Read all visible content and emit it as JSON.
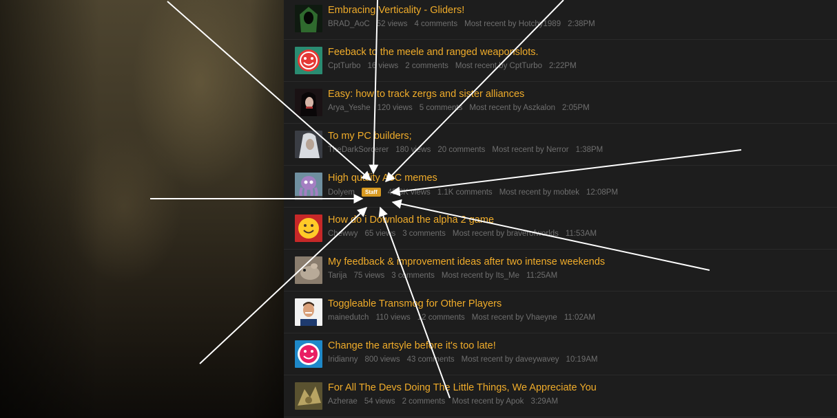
{
  "threads": [
    {
      "title": "Embracing Verticality - Gliders!",
      "author": "BRAD_AoC",
      "views": "52 views",
      "comments": "4 comments",
      "recent": "Most recent by Hotchy1989",
      "time": "2:38PM",
      "badge": "",
      "avatar": "hooded-figure-avatar"
    },
    {
      "title": "Feeback to the meele and ranged weaponslots.",
      "author": "CptTurbo",
      "views": "16 views",
      "comments": "2 comments",
      "recent": "Most recent by CptTurbo",
      "time": "2:22PM",
      "badge": "",
      "avatar": "red-smiley-avatar"
    },
    {
      "title": "Easy: how to track zergs and sister alliances",
      "author": "Arya_Yeshe",
      "views": "120 views",
      "comments": "5 comments",
      "recent": "Most recent by Aszkalon",
      "time": "2:05PM",
      "badge": "",
      "avatar": "dark-hair-portrait-avatar"
    },
    {
      "title": "To my PC builders;",
      "author": "TheDarkSorcerer",
      "views": "180 views",
      "comments": "20 comments",
      "recent": "Most recent by Nerror",
      "time": "1:38PM",
      "badge": "",
      "avatar": "white-hair-portrait-avatar"
    },
    {
      "title": "High quality AoC memes",
      "author": "Dolyem",
      "views": "45.8K views",
      "comments": "1.1K comments",
      "recent": "Most recent by mobtek",
      "time": "12:08PM",
      "badge": "Staff",
      "avatar": "purple-octopus-avatar"
    },
    {
      "title": "How do i Download the alpha 2 game",
      "author": "Chewwy",
      "views": "65 views",
      "comments": "3 comments",
      "recent": "Most recent by braverofworlds",
      "time": "11:53AM",
      "badge": "",
      "avatar": "yellow-smiley-avatar"
    },
    {
      "title": "My feedback & improvement ideas after two intense weekends",
      "author": "Tarija",
      "views": "75 views",
      "comments": "3 comments",
      "recent": "Most recent by Its_Me",
      "time": "11:25AM",
      "badge": "",
      "avatar": "rodent-photo-avatar"
    },
    {
      "title": "Toggleable Transmog for Other Players",
      "author": "mainedutch",
      "views": "110 views",
      "comments": "12 comments",
      "recent": "Most recent by Vhaeyne",
      "time": "11:02AM",
      "badge": "",
      "avatar": "man-photo-avatar"
    },
    {
      "title": "Change the artsyle before it's too late!",
      "author": "Iridianny",
      "views": "800 views",
      "comments": "43 comments",
      "recent": "Most recent by daveywavey",
      "time": "10:19AM",
      "badge": "",
      "avatar": "pink-smiley-avatar"
    },
    {
      "title": "For All The Devs Doing The Little Things, We Appreciate You",
      "author": "Azherae",
      "views": "54 views",
      "comments": "2 comments",
      "recent": "Most recent by Apok",
      "time": "3:29AM",
      "badge": "",
      "avatar": "creature-art-avatar"
    }
  ],
  "colors": {
    "title": "#f0ac2a",
    "meta": "#6f6f6f",
    "badge": "#d89a22",
    "arrow": "#ffffff"
  }
}
